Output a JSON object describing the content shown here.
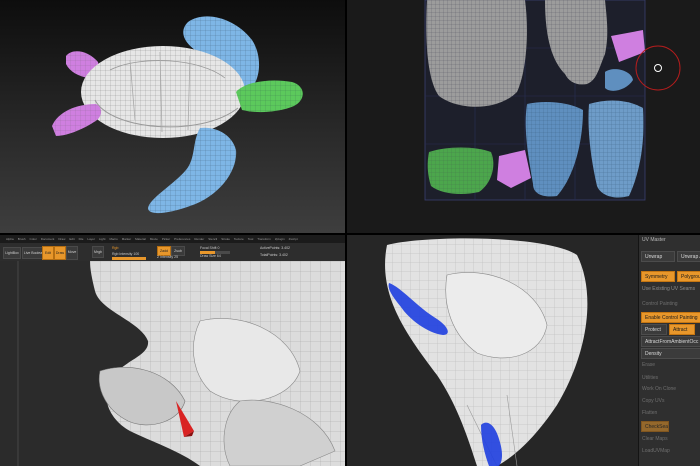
{
  "q3": {
    "menu_items": [
      "Alpha",
      "Brush",
      "Color",
      "Document",
      "Draw",
      "Edit",
      "File",
      "Layer",
      "Light",
      "Macro",
      "Marker",
      "Material",
      "Movie",
      "Picker",
      "Preferences",
      "Render",
      "Stencil",
      "Stroke",
      "Texture",
      "Tool",
      "Transform",
      "Zplugin",
      "Zscript"
    ],
    "toolbar": {
      "lightbox": "LightBox",
      "live_boolean": "Live Boolean",
      "edit": "Edit",
      "draw": "Draw",
      "move": "Move",
      "mrgb": "Mrgb",
      "rgb": "Rgb",
      "zadd": "Zadd",
      "zsub": "Zsub",
      "focal_shift": "Focal Shift 0",
      "draw_size": "Draw Size 64",
      "rgb_intensity": "Rgb Intensity 100",
      "z_intensity": "Z Intensity 25",
      "active_points": "ActivePoints: 3.402",
      "total_points": "TotalPoints: 3.402"
    }
  },
  "q4": {
    "panel_header": "UV Master",
    "items": {
      "unwrap": "Unwrap",
      "unwrap_all": "Unwrap All",
      "symmetry": "Symmetry",
      "polygroups": "Polygroups",
      "use_existing": "Use Existing UV Seams",
      "control_painting": "Control Painting",
      "enable_control_painting": "Enable Control Painting",
      "protect": "Protect",
      "attract": "Attract",
      "attract_ambient": "AttractFromAmbientOcc",
      "density": "Density",
      "erase": "Erase",
      "utilities": "Utilities",
      "work_on_clone": "Work On Clone",
      "copy_uvs": "Copy UVs",
      "paste_uvs": "Paste UVs",
      "flatten": "Flatten",
      "unflatten": "UnFlatten",
      "checkseams": "CheckSeams",
      "clear_maps": "Clear Maps",
      "load_uv_map": "LoadUVMap"
    }
  },
  "colors": {
    "shell": "#e6e6e6",
    "flipper_blue": "#7eb6e6",
    "head_green": "#5cc95c",
    "rear_magenta": "#cf7fe0",
    "uv_blue": "#5f8fbf",
    "accent_orange": "#e8972b",
    "paint_blue": "#1f3fe0",
    "marker_red": "#d92323"
  }
}
